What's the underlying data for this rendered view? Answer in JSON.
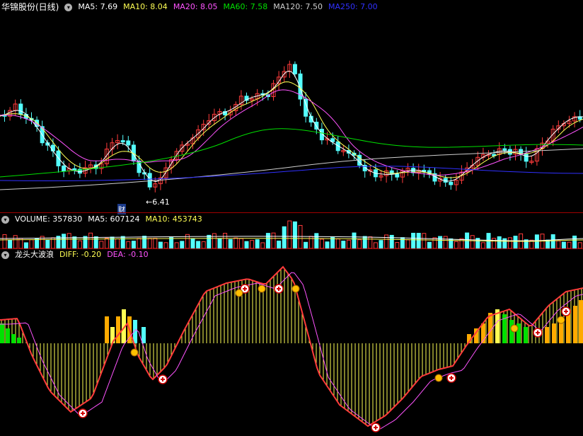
{
  "colors": {
    "up": "#ff3b3b",
    "down": "#54ffff",
    "ma5": "#ffffff",
    "ma10": "#ffff54",
    "ma20": "#ff54ff",
    "ma60": "#00e000",
    "ma120": "#cfcfcf",
    "ma250": "#3030ff",
    "diff": "#ffff54",
    "dea": "#ff54ff",
    "separator": "#a00000"
  },
  "price_pane": {
    "stock_name": "华锦股份(日线)",
    "dropdown_icon": "chevron-down-icon",
    "ma": [
      {
        "label": "MA5: 7.69",
        "color": "#ffffff"
      },
      {
        "label": "MA10: 8.04",
        "color": "#ffff54"
      },
      {
        "label": "MA20: 8.05",
        "color": "#ff54ff"
      },
      {
        "label": "MA60: 7.58",
        "color": "#00e000"
      },
      {
        "label": "MA120: 7.50",
        "color": "#cfcfcf"
      },
      {
        "label": "MA250: 7.00",
        "color": "#3030ff"
      }
    ],
    "low_marker": "←6.41",
    "finance_tag": "财"
  },
  "volume_pane": {
    "volume_label": "VOLUME: 357830",
    "ma5_label": "MA5: 607124",
    "ma10_label": "MA10: 453743"
  },
  "indicator_pane": {
    "name": "龙头大波浪",
    "diff_label": "DIFF: -0.20",
    "dea_label": "DEA: -0.10"
  }
}
